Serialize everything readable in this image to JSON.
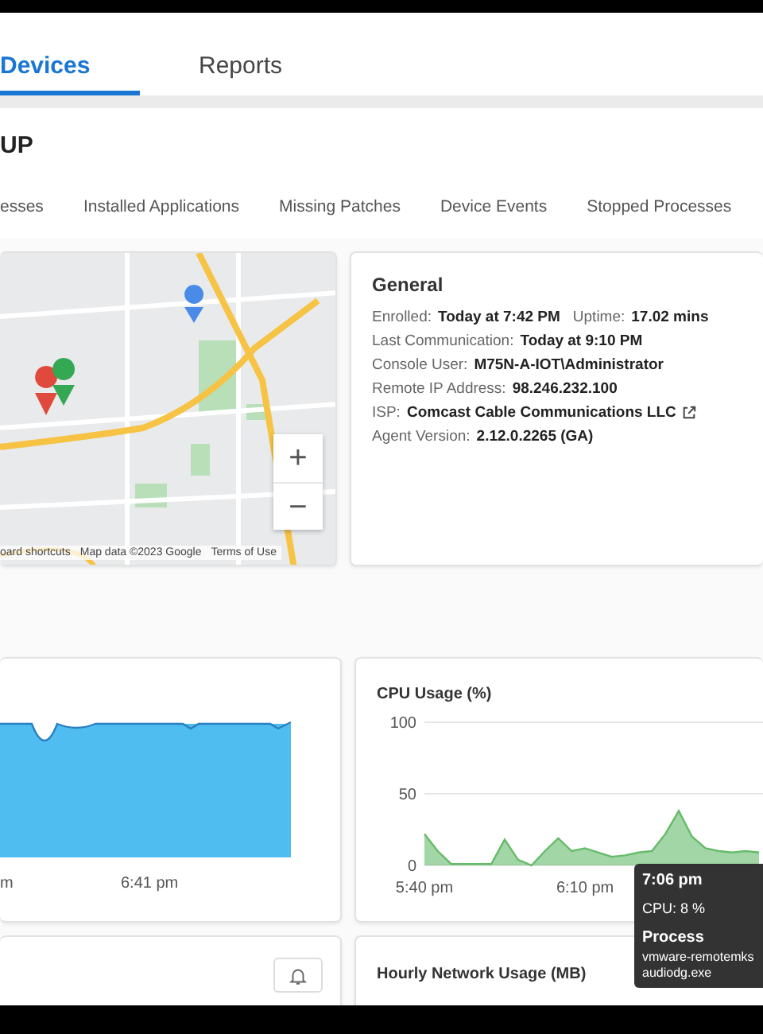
{
  "tabs": [
    {
      "label": "Devices",
      "selected": true
    },
    {
      "label": "Reports",
      "selected": false
    }
  ],
  "device_name": "UP",
  "sub_tabs": [
    {
      "label": "esses",
      "selected": false
    },
    {
      "label": "Installed Applications",
      "selected": false
    },
    {
      "label": "Missing Patches",
      "selected": false
    },
    {
      "label": "Device Events",
      "selected": false
    },
    {
      "label": "Stopped Processes",
      "selected": false
    }
  ],
  "map": {
    "zoom_in": "+",
    "zoom_out": "−",
    "attribution": [
      "oard shortcuts",
      "Map data ©2023 Google",
      "Terms of Use"
    ]
  },
  "general": {
    "title": "General",
    "rows": [
      [
        {
          "label": "Enrolled:",
          "value": "Today at 7:42 PM",
          "external_link": false
        },
        {
          "label": "Uptime:",
          "value": "17.02 mins",
          "external_link": false
        }
      ],
      [
        {
          "label": "Last Communication:",
          "value": "Today at 9:10 PM",
          "external_link": false
        }
      ],
      [
        {
          "label": "Console User:",
          "value": "M75N-A-IOT\\Administrator",
          "external_link": false
        }
      ],
      [
        {
          "label": "Remote IP Address:",
          "value": "98.246.232.100",
          "external_link": false
        }
      ],
      [
        {
          "label": "ISP:",
          "value": "Comcast Cable Communications LLC",
          "external_link": true
        }
      ],
      [
        {
          "label": "Agent Version:",
          "value": "2.12.0.2265 (GA)",
          "external_link": false
        }
      ]
    ]
  },
  "memory_chart": {
    "x_labels": [
      "m",
      "6:41 pm"
    ]
  },
  "cpu_chart": {
    "title": "CPU Usage (%)",
    "chart_data": {
      "type": "area",
      "categories": [
        "5:40 pm",
        null,
        null,
        null,
        null,
        null,
        null,
        null,
        null,
        null,
        null,
        null,
        "6:10 pm",
        null,
        null,
        null,
        null,
        null,
        null,
        null,
        null,
        null,
        null,
        null,
        null,
        null
      ],
      "values": [
        22,
        10,
        1,
        1,
        1,
        1,
        18,
        4,
        0,
        10,
        19,
        10,
        12,
        9,
        6,
        7,
        9,
        10,
        22,
        38,
        20,
        12,
        10,
        9,
        10,
        9
      ],
      "ylim": [
        0,
        100
      ],
      "yticks": [
        0,
        50,
        100
      ]
    },
    "tooltip": {
      "time": "7:06 pm",
      "reading": "CPU: 8 %",
      "heading": "Process",
      "lines": [
        "vmware-remotemks",
        "audiodg.exe"
      ]
    }
  },
  "network_card": {
    "title": "Hourly Network Usage (MB)"
  }
}
